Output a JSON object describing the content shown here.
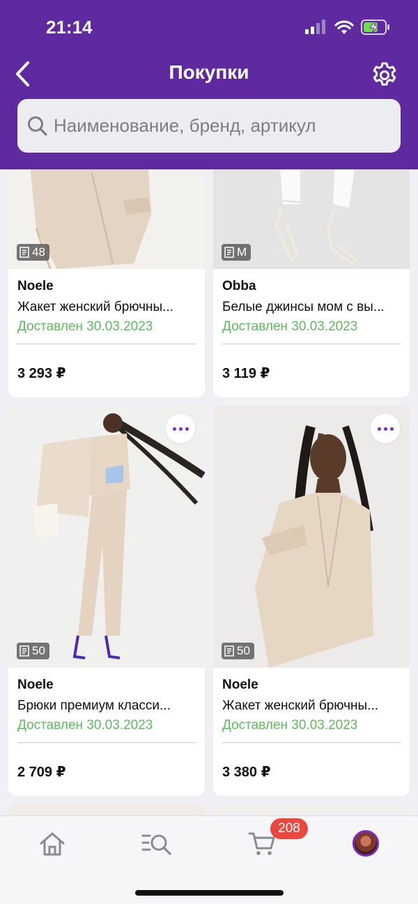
{
  "status_bar": {
    "time": "21:14"
  },
  "header": {
    "title": "Покупки",
    "search_placeholder": "Наименование, бренд, артикул"
  },
  "products": [
    {
      "brand": "Noele",
      "name": "Жакет женский брючны...",
      "status": "Доставлен 30.03.2023",
      "price": "3 293 ₽",
      "size": "48"
    },
    {
      "brand": "Obba",
      "name": "Белые джинсы мом с вы...",
      "status": "Доставлен 30.03.2023",
      "price": "3 119 ₽",
      "size": "M"
    },
    {
      "brand": "Noele",
      "name": "Брюки премиум класси...",
      "status": "Доставлен 30.03.2023",
      "price": "2 709 ₽",
      "size": "50"
    },
    {
      "brand": "Noele",
      "name": "Жакет женский брючны...",
      "status": "Доставлен 30.03.2023",
      "price": "3 380 ₽",
      "size": "50"
    }
  ],
  "tab_bar": {
    "items": [
      "home-icon",
      "catalog-search-icon",
      "cart-icon",
      "profile-avatar"
    ],
    "cart_count": "208"
  },
  "colors": {
    "header_bg": "#5f2a9f",
    "status_delivered": "#5cbb5c",
    "accent": "#7a2bc7",
    "badge": "#e9473f"
  }
}
